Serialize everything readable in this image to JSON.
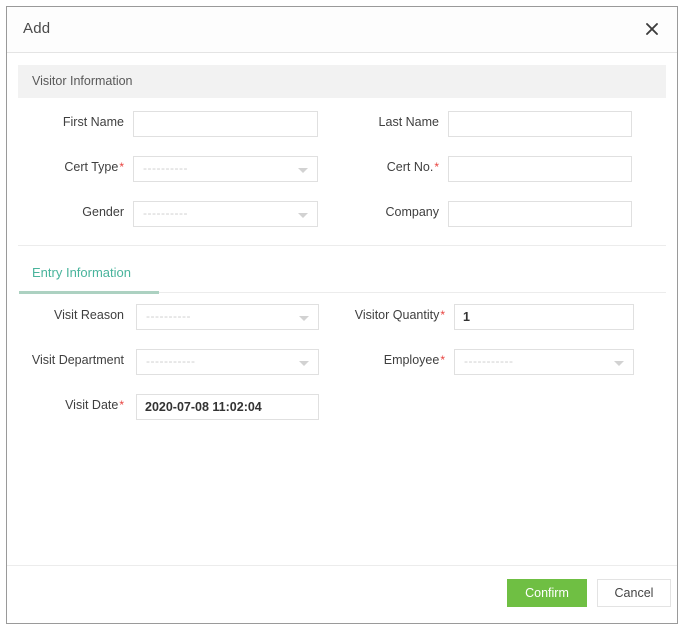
{
  "dialog": {
    "title": "Add",
    "close_icon": "close-icon"
  },
  "visitor_section": {
    "header": "Visitor Information",
    "fields": [
      {
        "label": "First Name",
        "required": false,
        "type": "input",
        "value": "",
        "placeholder": ""
      },
      {
        "label": "Last Name",
        "required": false,
        "type": "input",
        "value": "",
        "placeholder": ""
      },
      {
        "label": "Cert Type",
        "required": true,
        "type": "select",
        "value": "",
        "placeholder": "----------"
      },
      {
        "label": "Cert No.",
        "required": true,
        "type": "input",
        "value": "",
        "placeholder": ""
      },
      {
        "label": "Gender",
        "required": false,
        "type": "select",
        "value": "",
        "placeholder": "----------"
      },
      {
        "label": "Company",
        "required": false,
        "type": "input",
        "value": "",
        "placeholder": ""
      }
    ]
  },
  "entry_section": {
    "tab_label": "Entry Information",
    "fields": [
      {
        "label": "Visit Reason",
        "required": false,
        "type": "select",
        "value": "",
        "placeholder": "----------"
      },
      {
        "label": "Visitor Quantity",
        "required": true,
        "type": "input",
        "value": "1",
        "placeholder": ""
      },
      {
        "label": "Visit Department",
        "required": false,
        "type": "select",
        "value": "",
        "placeholder": "-----------"
      },
      {
        "label": "Employee",
        "required": true,
        "type": "select",
        "value": "",
        "placeholder": "-----------"
      },
      {
        "label": "Visit Date",
        "required": true,
        "type": "input",
        "value": "2020-07-08 11:02:04",
        "placeholder": ""
      }
    ]
  },
  "footer": {
    "confirm_label": "Confirm",
    "cancel_label": "Cancel"
  },
  "colors": {
    "confirm_green": "#6fbf43",
    "tab_teal": "#49b49c",
    "required_red": "#e8433f",
    "section_bar": "#f2f2f2"
  }
}
